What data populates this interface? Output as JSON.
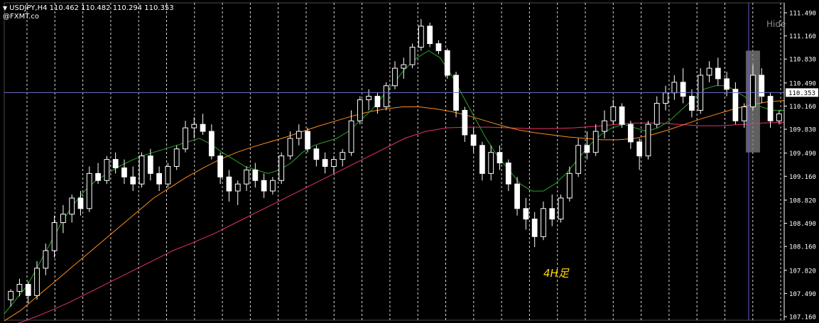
{
  "header": {
    "symbol_line": "USDJPY,H4  110.462 110.482 110.294 110.353",
    "broker": "@FXMT.co"
  },
  "hide_label": "Hide",
  "annotation": "4H足",
  "colors": {
    "background": "#000000",
    "candle": "#ffffff",
    "grid": "#ffffff",
    "ma_fast": "#2ca02c",
    "ma_mid": "#ff8c1a",
    "ma_slow": "#e6336b",
    "price_line": "#6e73c8",
    "cursor_line": "#6a5acd",
    "highlight": "#808080"
  },
  "chart_data": {
    "type": "candlestick",
    "symbol": "USDJPY",
    "timeframe": "H4",
    "current_price": 110.353,
    "ylim": [
      107.0,
      111.6
    ],
    "y_ticks": [
      111.49,
      111.16,
      110.83,
      110.49,
      110.16,
      109.83,
      109.49,
      109.16,
      108.82,
      108.49,
      108.16,
      107.82,
      107.49,
      107.16
    ],
    "y_tick_labels": [
      "111.490",
      "111.160",
      "110.830",
      "110.490",
      "110.160",
      "109.830",
      "109.490",
      "109.160",
      "108.820",
      "108.490",
      "108.160",
      "107.820",
      "107.490",
      "107.160"
    ],
    "grid": true,
    "highlighted_candle_index": 85,
    "candles": [
      [
        107.4,
        107.55,
        107.3,
        107.52
      ],
      [
        107.52,
        107.7,
        107.45,
        107.62
      ],
      [
        107.62,
        107.66,
        107.35,
        107.46
      ],
      [
        107.46,
        107.95,
        107.4,
        107.85
      ],
      [
        107.85,
        108.2,
        107.75,
        108.1
      ],
      [
        108.1,
        108.6,
        108.0,
        108.5
      ],
      [
        108.5,
        108.75,
        108.35,
        108.62
      ],
      [
        108.62,
        108.9,
        108.5,
        108.85
      ],
      [
        108.85,
        108.95,
        108.6,
        108.7
      ],
      [
        108.7,
        109.3,
        108.65,
        109.2
      ],
      [
        109.2,
        109.35,
        109.05,
        109.1
      ],
      [
        109.1,
        109.45,
        109.05,
        109.4
      ],
      [
        109.4,
        109.5,
        109.2,
        109.28
      ],
      [
        109.28,
        109.4,
        109.05,
        109.15
      ],
      [
        109.15,
        109.3,
        108.95,
        109.05
      ],
      [
        109.05,
        109.5,
        109.0,
        109.45
      ],
      [
        109.45,
        109.55,
        109.1,
        109.2
      ],
      [
        109.2,
        109.3,
        108.95,
        109.05
      ],
      [
        109.05,
        109.35,
        109.0,
        109.3
      ],
      [
        109.3,
        109.6,
        109.25,
        109.55
      ],
      [
        109.55,
        109.95,
        109.5,
        109.85
      ],
      [
        109.85,
        110.0,
        109.7,
        109.9
      ],
      [
        109.9,
        110.05,
        109.75,
        109.8
      ],
      [
        109.8,
        109.9,
        109.4,
        109.45
      ],
      [
        109.45,
        109.5,
        109.05,
        109.15
      ],
      [
        109.15,
        109.25,
        108.8,
        108.95
      ],
      [
        108.95,
        109.1,
        108.75,
        109.05
      ],
      [
        109.05,
        109.3,
        108.95,
        109.25
      ],
      [
        109.25,
        109.35,
        109.0,
        109.1
      ],
      [
        109.1,
        109.2,
        108.85,
        108.95
      ],
      [
        108.95,
        109.15,
        108.9,
        109.1
      ],
      [
        109.1,
        109.5,
        109.05,
        109.45
      ],
      [
        109.45,
        109.8,
        109.4,
        109.7
      ],
      [
        109.7,
        109.9,
        109.6,
        109.8
      ],
      [
        109.8,
        109.85,
        109.5,
        109.55
      ],
      [
        109.55,
        109.6,
        109.3,
        109.4
      ],
      [
        109.4,
        109.5,
        109.2,
        109.3
      ],
      [
        109.3,
        109.45,
        109.2,
        109.4
      ],
      [
        109.4,
        109.55,
        109.3,
        109.5
      ],
      [
        109.5,
        110.1,
        109.45,
        109.95
      ],
      [
        109.95,
        110.3,
        109.9,
        110.25
      ],
      [
        110.25,
        110.4,
        110.1,
        110.3
      ],
      [
        110.3,
        110.35,
        110.05,
        110.15
      ],
      [
        110.15,
        110.5,
        110.1,
        110.45
      ],
      [
        110.45,
        110.8,
        110.4,
        110.7
      ],
      [
        110.7,
        110.85,
        110.55,
        110.75
      ],
      [
        110.75,
        111.05,
        110.7,
        111.0
      ],
      [
        111.0,
        111.4,
        110.95,
        111.3
      ],
      [
        111.3,
        111.35,
        111.0,
        111.05
      ],
      [
        111.05,
        111.1,
        110.9,
        110.95
      ],
      [
        110.95,
        110.98,
        110.55,
        110.6
      ],
      [
        110.6,
        110.65,
        110.0,
        110.1
      ],
      [
        110.1,
        110.15,
        109.65,
        109.75
      ],
      [
        109.75,
        109.85,
        109.5,
        109.6
      ],
      [
        109.6,
        109.65,
        109.1,
        109.2
      ],
      [
        109.2,
        109.6,
        109.1,
        109.5
      ],
      [
        109.5,
        109.6,
        109.25,
        109.35
      ],
      [
        109.35,
        109.4,
        108.95,
        109.05
      ],
      [
        109.05,
        109.15,
        108.6,
        108.7
      ],
      [
        108.7,
        108.85,
        108.4,
        108.55
      ],
      [
        108.55,
        108.65,
        108.15,
        108.3
      ],
      [
        108.3,
        108.8,
        108.25,
        108.7
      ],
      [
        108.7,
        108.9,
        108.45,
        108.55
      ],
      [
        108.55,
        108.9,
        108.5,
        108.85
      ],
      [
        108.85,
        109.3,
        108.8,
        109.2
      ],
      [
        109.2,
        109.7,
        109.15,
        109.6
      ],
      [
        109.6,
        109.8,
        109.4,
        109.5
      ],
      [
        109.5,
        109.9,
        109.45,
        109.8
      ],
      [
        109.8,
        110.1,
        109.7,
        109.95
      ],
      [
        109.95,
        110.25,
        109.9,
        110.15
      ],
      [
        110.15,
        110.2,
        109.85,
        109.9
      ],
      [
        109.9,
        109.95,
        109.55,
        109.65
      ],
      [
        109.65,
        109.7,
        109.25,
        109.45
      ],
      [
        109.45,
        109.95,
        109.4,
        109.9
      ],
      [
        109.9,
        110.3,
        109.85,
        110.2
      ],
      [
        110.2,
        110.45,
        110.1,
        110.35
      ],
      [
        110.35,
        110.6,
        110.25,
        110.5
      ],
      [
        110.5,
        110.7,
        110.2,
        110.3
      ],
      [
        110.3,
        110.4,
        110.0,
        110.1
      ],
      [
        110.1,
        110.7,
        110.05,
        110.6
      ],
      [
        110.6,
        110.8,
        110.5,
        110.7
      ],
      [
        110.7,
        110.85,
        110.45,
        110.55
      ],
      [
        110.55,
        110.65,
        110.3,
        110.4
      ],
      [
        110.4,
        110.5,
        109.9,
        109.95
      ],
      [
        109.95,
        110.2,
        109.85,
        110.15
      ],
      [
        110.15,
        110.75,
        110.1,
        110.6
      ],
      [
        110.6,
        110.7,
        110.2,
        110.3
      ],
      [
        110.3,
        110.35,
        109.85,
        109.95
      ],
      [
        109.95,
        110.1,
        109.9,
        110.05
      ]
    ],
    "ma_fast": [
      107.2,
      107.4,
      107.6,
      107.9,
      108.2,
      108.5,
      108.75,
      108.95,
      109.1,
      109.2,
      109.3,
      109.38,
      109.45,
      109.5,
      109.55,
      109.6,
      109.65,
      109.7,
      109.62,
      109.5,
      109.4,
      109.3,
      109.25,
      109.2,
      109.25,
      109.35,
      109.5,
      109.6,
      109.65,
      109.7,
      109.8,
      109.95,
      110.1,
      110.3,
      110.5,
      110.7,
      110.85,
      110.95,
      110.85,
      110.6,
      110.3,
      110.0,
      109.7,
      109.45,
      109.25,
      109.05,
      108.95,
      108.95,
      109.05,
      109.2,
      109.4,
      109.6,
      109.75,
      109.85,
      109.9,
      109.85,
      109.8,
      109.85,
      109.95,
      110.1,
      110.25,
      110.4,
      110.45,
      110.45,
      110.35,
      110.25,
      110.15,
      110.1,
      110.1
    ],
    "ma_mid": [
      107.1,
      107.25,
      107.45,
      107.65,
      107.85,
      108.05,
      108.25,
      108.45,
      108.65,
      108.85,
      109.0,
      109.15,
      109.28,
      109.4,
      109.5,
      109.58,
      109.65,
      109.72,
      109.8,
      109.88,
      109.95,
      110.02,
      110.08,
      110.12,
      110.15,
      110.15,
      110.12,
      110.08,
      110.02,
      109.95,
      109.88,
      109.82,
      109.78,
      109.75,
      109.72,
      109.7,
      109.68,
      109.68,
      109.7,
      109.75,
      109.82,
      109.9,
      109.98,
      110.05,
      110.12,
      110.18,
      110.22,
      110.24
    ],
    "ma_slow": [
      107.0,
      107.1,
      107.22,
      107.35,
      107.5,
      107.65,
      107.8,
      107.95,
      108.1,
      108.22,
      108.35,
      108.5,
      108.65,
      108.8,
      108.95,
      109.1,
      109.25,
      109.4,
      109.55,
      109.7,
      109.8,
      109.85,
      109.86,
      109.86,
      109.85,
      109.84,
      109.84,
      109.85,
      109.87,
      109.9,
      109.92,
      109.92,
      109.9,
      109.88,
      109.88,
      109.9,
      109.92,
      109.93
    ]
  }
}
